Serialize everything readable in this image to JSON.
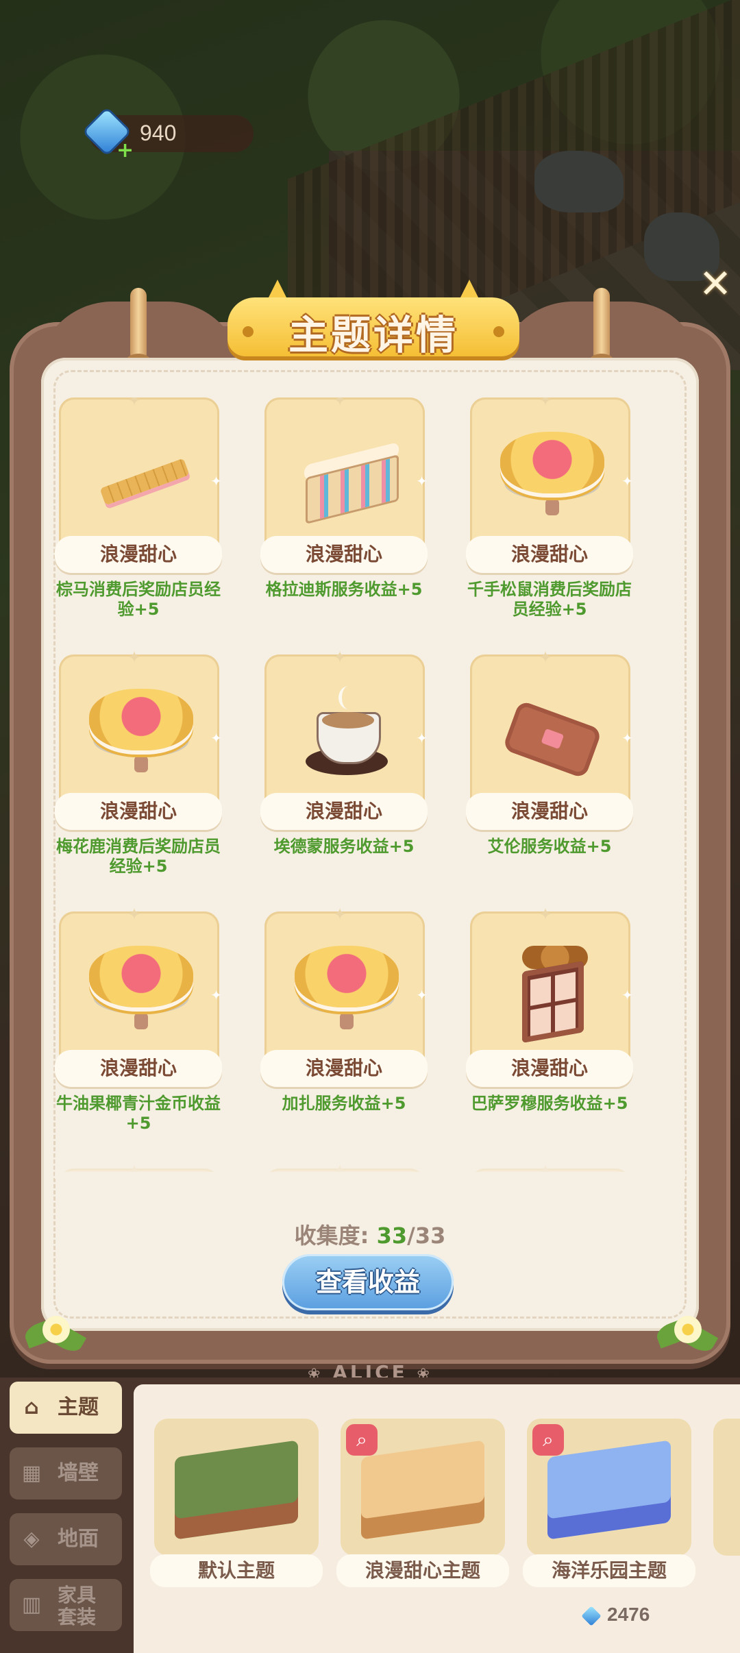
{
  "hud": {
    "gem_count": "940"
  },
  "modal": {
    "title": "主题详情",
    "items": [
      {
        "tag": "浪漫甜心",
        "desc": "棕马消费后奖励店员经验+5",
        "art": "bar-cookie"
      },
      {
        "tag": "浪漫甜心",
        "desc": "格拉迪斯服务收益+5",
        "art": "shelf"
      },
      {
        "tag": "浪漫甜心",
        "desc": "千手松鼠消费后奖励店员经验+5",
        "art": "cookie-flower"
      },
      {
        "tag": "浪漫甜心",
        "desc": "梅花鹿消费后奖励店员经验+5",
        "art": "cookie-flower"
      },
      {
        "tag": "浪漫甜心",
        "desc": "埃德蒙服务收益+5",
        "art": "coffee"
      },
      {
        "tag": "浪漫甜心",
        "desc": "艾伦服务收益+5",
        "art": "biscuit"
      },
      {
        "tag": "浪漫甜心",
        "desc": "牛油果椰青汁金币收益+5",
        "art": "cookie-flower"
      },
      {
        "tag": "浪漫甜心",
        "desc": "加扎服务收益+5",
        "art": "cookie-flower"
      },
      {
        "tag": "浪漫甜心",
        "desc": "巴萨罗穆服务收益+5",
        "art": "window"
      }
    ],
    "collection_label": "收集度:",
    "collection_current": "33",
    "collection_total": "/33",
    "view_earnings_label": "查看收益",
    "plate_text": "ALICE"
  },
  "side_tabs": [
    {
      "label": "主题",
      "icon": "home-icon",
      "active": true
    },
    {
      "label": "墙壁",
      "icon": "brick-wall-icon",
      "active": false
    },
    {
      "label": "地面",
      "icon": "floor-tiles-icon",
      "active": false
    },
    {
      "label": "家具套装",
      "label_line1": "家具",
      "label_line2": "套装",
      "icon": "furniture-set-icon",
      "active": false
    }
  ],
  "themes": [
    {
      "name": "默认主题",
      "color": "#6e8c4a"
    },
    {
      "name": "浪漫甜心主题",
      "color": "#c98a4e",
      "has_search_badge": true
    },
    {
      "name": "海洋乐园主题",
      "color": "#5a6fd6",
      "has_search_badge": true
    }
  ],
  "price": {
    "value": "2476"
  },
  "colors": {
    "accent_green": "#4e9a2e",
    "button_blue": "#5a9ee0",
    "frame_brown": "#8a6554"
  }
}
